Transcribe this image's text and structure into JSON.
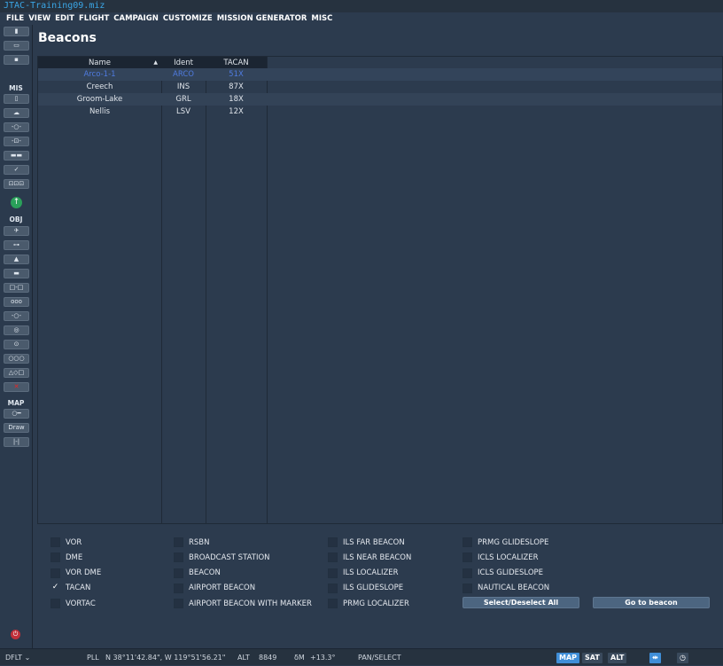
{
  "window": {
    "title": "JTAC-Training09.miz"
  },
  "menu": [
    "FILE",
    "VIEW",
    "EDIT",
    "FLIGHT",
    "CAMPAIGN",
    "CUSTOMIZE",
    "MISSION GENERATOR",
    "MISC"
  ],
  "sidebar": {
    "mis_label": "MIS",
    "obj_label": "OBJ",
    "map_label": "MAP",
    "draw_label": "Draw"
  },
  "page": {
    "title": "Beacons"
  },
  "table": {
    "columns": [
      "Name",
      "Ident",
      "TACAN"
    ],
    "rows": [
      {
        "name": "Arco-1-1",
        "ident": "ARCO",
        "tacan": "51X",
        "selected": true
      },
      {
        "name": "Creech",
        "ident": "INS",
        "tacan": "87X"
      },
      {
        "name": "Groom-Lake",
        "ident": "GRL",
        "tacan": "18X"
      },
      {
        "name": "Nellis",
        "ident": "LSV",
        "tacan": "12X"
      }
    ]
  },
  "filters": [
    {
      "label": "VOR",
      "checked": false
    },
    {
      "label": "DME",
      "checked": false
    },
    {
      "label": "VOR DME",
      "checked": false
    },
    {
      "label": "TACAN",
      "checked": true
    },
    {
      "label": "VORTAC",
      "checked": false
    },
    {
      "label": "RSBN",
      "checked": false
    },
    {
      "label": "BROADCAST STATION",
      "checked": false
    },
    {
      "label": "BEACON",
      "checked": false
    },
    {
      "label": "AIRPORT BEACON",
      "checked": false
    },
    {
      "label": "AIRPORT BEACON WITH MARKER",
      "checked": false
    },
    {
      "label": "ILS FAR BEACON",
      "checked": false
    },
    {
      "label": "ILS NEAR BEACON",
      "checked": false
    },
    {
      "label": "ILS LOCALIZER",
      "checked": false
    },
    {
      "label": "ILS GLIDESLOPE",
      "checked": false
    },
    {
      "label": "PRMG LOCALIZER",
      "checked": false
    },
    {
      "label": "PRMG GLIDESLOPE",
      "checked": false
    },
    {
      "label": "ICLS LOCALIZER",
      "checked": false
    },
    {
      "label": "ICLS GLIDESLOPE",
      "checked": false
    },
    {
      "label": "NAUTICAL BEACON",
      "checked": false
    }
  ],
  "buttons": {
    "select_all": "Select/Deselect All",
    "go_to": "Go to beacon"
  },
  "status": {
    "profile": "DFLT",
    "coord_label": "PLL",
    "coords": "N 38°11'42.84\", W 119°51'56.21\"",
    "alt_label": "ALT",
    "alt": "8849",
    "dm_label": "δM",
    "dm": "+13.3°",
    "mode": "PAN/SELECT",
    "map": "MAP",
    "sat": "SAT",
    "alt_btn": "ALT"
  }
}
